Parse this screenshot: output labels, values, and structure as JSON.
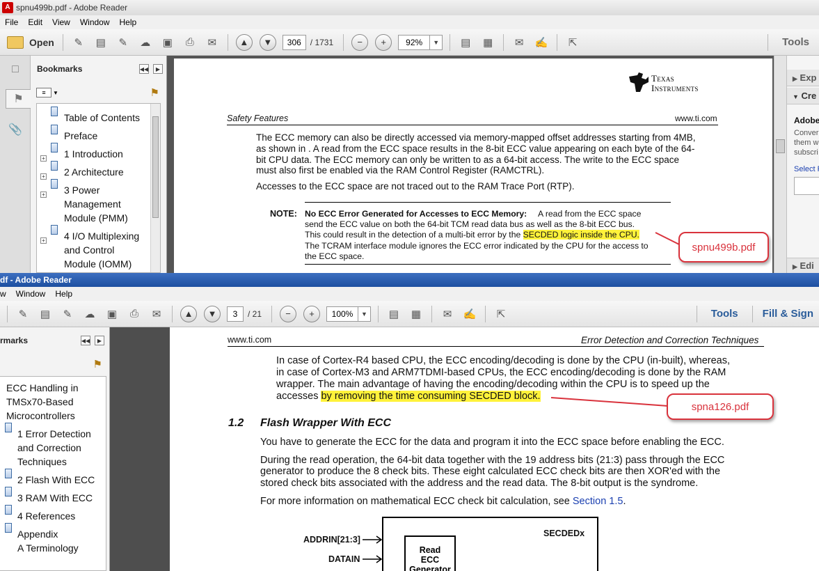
{
  "window1": {
    "title": "spnu499b.pdf - Adobe Reader",
    "menu": [
      "File",
      "Edit",
      "View",
      "Window",
      "Help"
    ],
    "toolbar": {
      "open_label": "Open",
      "page_current": "306",
      "page_total": "/ 1731",
      "zoom": "92%",
      "tools_label": "Tools"
    },
    "bookmarks": {
      "header": "Bookmarks",
      "items": [
        {
          "text": "Table of Contents",
          "expandable": false
        },
        {
          "text": "Preface",
          "expandable": false
        },
        {
          "text": "1  Introduction",
          "expandable": true
        },
        {
          "text": "2  Architecture",
          "expandable": true
        },
        {
          "text": "3  Power",
          "text2": "Management",
          "text3": "Module (PMM)",
          "expandable": true
        },
        {
          "text": "4  I/O Multiplexing",
          "text2": "and Control",
          "text3": "Module (IOMM)",
          "expandable": true
        }
      ]
    },
    "right_pane": {
      "row1": "Exp",
      "row2": "Cre",
      "row3": "Adobe",
      "row4": "Conver",
      "row5": "them w",
      "row6": "subscri",
      "row7": "Select F",
      "row8": "Edi"
    },
    "page": {
      "logo_line1": "Texas",
      "logo_line2": "Instruments",
      "header_left": "Safety Features",
      "header_right": "www.ti.com",
      "para1": [
        "The ECC memory can also be directly accessed via memory-mapped offset addresses starting from 4MB,",
        "as shown in . A read from the ECC space results in the 8-bit ECC value appearing on each byte of the 64-",
        "bit CPU data. The ECC memory can only be written to as a 64-bit access. The write to the ECC space",
        "must also first be enabled via the RAM Control Register (RAMCTRL)."
      ],
      "para2": "Accesses to the ECC space are not traced out to the RAM Trace Port (RTP).",
      "note_label": "NOTE:",
      "note_bold": "No ECC Error Generated for Accesses to ECC Memory:",
      "note_line1_rest": " A read from the ECC space",
      "note_line2": "send the ECC value on both the 64-bit TCM read data bus as well as the 8-bit ECC bus.",
      "note_line3_pre": "This could result in the detection of a multi-bit error by the ",
      "note_line3_hl": "SECDED logic inside the CPU.",
      "note_line4": "The TCRAM interface module ignores the ECC error indicated by the CPU for the access to",
      "note_line5": "the ECC space."
    },
    "callout": "spnu499b.pdf"
  },
  "window2": {
    "title": "df - Adobe Reader",
    "menu": [
      "w",
      "Window",
      "Help"
    ],
    "toolbar": {
      "page_current": "3",
      "page_total": "/ 21",
      "zoom": "100%",
      "tools_label": "Tools",
      "fill_sign_label": "Fill & Sign"
    },
    "bookmarks": {
      "header": "rmarks",
      "items": [
        {
          "text": "ECC Handling in",
          "text2": "TMSx70-Based",
          "text3": "Microcontrollers"
        },
        {
          "text": "1  Error Detection",
          "text2": "and Correction",
          "text3": "Techniques"
        },
        {
          "text": "2  Flash With ECC"
        },
        {
          "text": "3  RAM With ECC"
        },
        {
          "text": "4  References"
        },
        {
          "text": "Appendix",
          "text2": "A  Terminology"
        }
      ]
    },
    "page": {
      "header_left": "www.ti.com",
      "header_right": "Error Detection and Correction Techniques",
      "para1": [
        "In case of Cortex-R4 based CPU, the ECC encoding/decoding is done by the CPU (in-built), whereas,",
        "in case of Cortex-M3 and ARM7TDMI-based CPUs, the ECC encoding/decoding is done by the RAM",
        "wrapper. The main advantage of having the encoding/decoding within the CPU is to speed up the"
      ],
      "para1_last_pre": "accesses ",
      "para1_last_hl": "by removing the time consuming SECDED block.",
      "section_num": "1.2",
      "section_title": "Flash Wrapper With ECC",
      "para2": "You have to generate the ECC for the data and program it into the ECC space before enabling the ECC.",
      "para3": [
        "During the read operation, the 64-bit data together with the 19 address bits (21:3) pass through the ECC",
        "generator to produce the 8 check bits. These eight calculated ECC check bits are then XOR'ed with the",
        "stored check bits associated with the address and the read data. The 8-bit output is the syndrome."
      ],
      "para4_pre": "For more information on mathematical ECC check bit calculation, see ",
      "para4_link": "Section 1.5",
      "para4_post": ".",
      "diagram": {
        "addrin": "ADDRIN[21:3]",
        "datain": "DATAIN",
        "block": "SECDEDx",
        "box_line1": "Read",
        "box_line2": "ECC",
        "box_line3": "Generator"
      }
    },
    "callout": "spna126.pdf"
  },
  "colors": {
    "highlight": "#fff23a",
    "callout_red": "#d9323c",
    "link_blue": "#1a3fb0",
    "title_blue": "#1d4fa0"
  }
}
